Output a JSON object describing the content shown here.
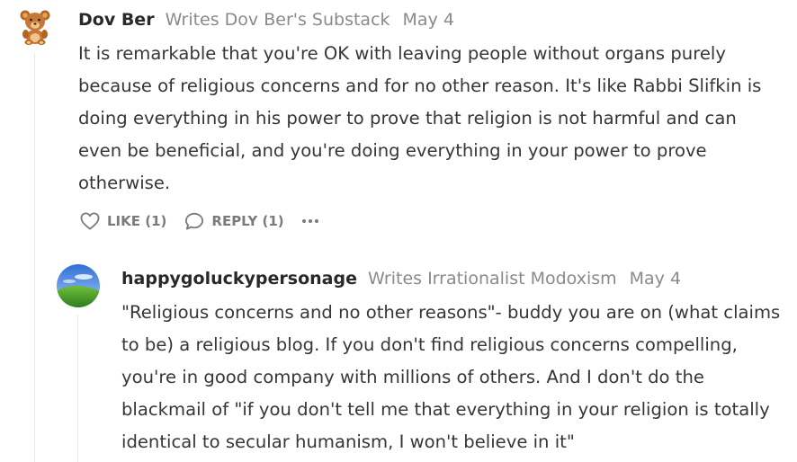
{
  "comments": [
    {
      "author": "Dov Ber",
      "writes": "Writes Dov Ber's Substack",
      "date": "May 4",
      "avatar_icon": "teddy-bear-icon",
      "body": "It is remarkable that you're OK with leaving people without organs purely because of religious concerns and for no other reason. It's like Rabbi Slifkin is doing everything in his power to prove that religion is not harmful and can even be beneficial, and you're doing everything in your power to prove otherwise.",
      "like_label": "LIKE (1)",
      "reply_label": "REPLY (1)",
      "more_icon": "ellipsis-icon"
    },
    {
      "author": "happygoluckypersonage",
      "writes": "Writes Irrationalist Modoxism",
      "date": "May 4",
      "avatar_icon": "landscape-hill-icon",
      "body": "\"Religious concerns and no other reasons\"- buddy you are on (what claims to be) a religious blog. If you don't find religious concerns compelling, you're in good company with millions of others. And I don't do the blackmail of \"if you don't tell me that everything in your religion is totally identical to secular humanism, I won't believe in it\""
    }
  ]
}
